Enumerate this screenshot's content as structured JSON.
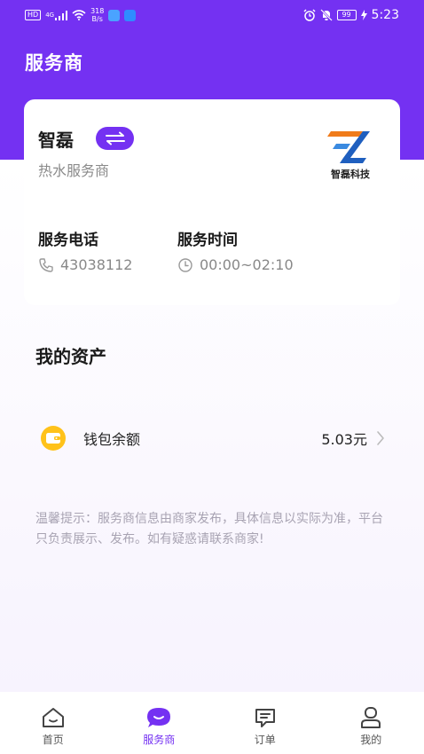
{
  "status_bar": {
    "hd": "HD",
    "signal_label": "4G",
    "net_speed_value": "318",
    "net_speed_unit": "B/s",
    "battery": "99",
    "time": "5:23"
  },
  "header": {
    "title": "服务商"
  },
  "merchant": {
    "name": "智磊",
    "subtitle": "热水服务商",
    "logo_text": "智磊科技",
    "phone_label": "服务电话",
    "phone_value": "43038112",
    "time_label": "服务时间",
    "time_value": "00:00~02:10"
  },
  "assets": {
    "title": "我的资产",
    "wallet_label": "钱包余额",
    "wallet_value": "5.03元"
  },
  "notice": "温馨提示：服务商信息由商家发布，具体信息以实际为准，平台只负责展示、发布。如有疑惑请联系商家!",
  "tabs": [
    {
      "label": "首页",
      "icon": "home-icon"
    },
    {
      "label": "服务商",
      "icon": "chat-bubble-icon"
    },
    {
      "label": "订单",
      "icon": "order-icon"
    },
    {
      "label": "我的",
      "icon": "profile-icon"
    }
  ],
  "colors": {
    "accent": "#7431f2",
    "wallet": "#ffc21a"
  }
}
